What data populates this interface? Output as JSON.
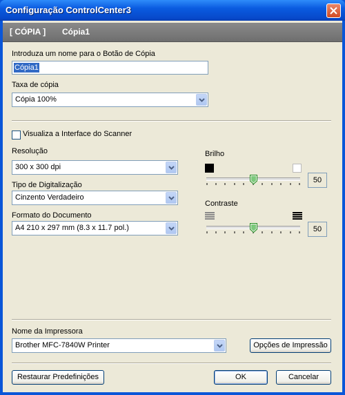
{
  "window": {
    "title": "Configuração ControlCenter3"
  },
  "header": {
    "section": "[ CÓPIA ]",
    "name": "Cópia1"
  },
  "copy_button_name": {
    "label": "Introduza um nome para o Botão de Cópia",
    "value": "Cópia1"
  },
  "copy_ratio": {
    "label": "Taxa de cópia",
    "value": "Cópia 100%"
  },
  "scanner_interface": {
    "label": "Visualiza a Interface do Scanner",
    "checked": false
  },
  "resolution": {
    "label": "Resolução",
    "value": "300 x 300 dpi"
  },
  "scan_type": {
    "label": "Tipo de Digitalização",
    "value": "Cinzento Verdadeiro"
  },
  "document_size": {
    "label": "Formato do Documento",
    "value": "A4 210 x 297 mm (8.3 x 11.7 pol.)"
  },
  "brightness": {
    "label": "Brilho",
    "value": "50"
  },
  "contrast": {
    "label": "Contraste",
    "value": "50"
  },
  "printer": {
    "label": "Nome da Impressora",
    "value": "Brother MFC-7840W Printer",
    "options_button": "Opções de Impressão"
  },
  "footer": {
    "restore": "Restaurar Predefinições",
    "ok": "OK",
    "cancel": "Cancelar"
  }
}
